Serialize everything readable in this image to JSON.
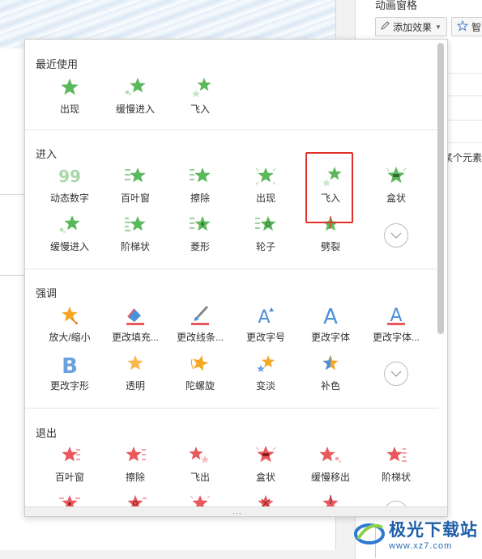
{
  "pane": {
    "title": "动画窗格",
    "add_effect": "添加效果",
    "smart_partial": "智",
    "element_text": "某个元素"
  },
  "watermark": {
    "title": "极光下载站",
    "url": "www.xz7.com"
  },
  "sections": {
    "recent": {
      "title": "最近使用",
      "items": [
        "出现",
        "缓慢进入",
        "飞入"
      ]
    },
    "entrance": {
      "title": "进入",
      "row1": [
        "动态数字",
        "百叶窗",
        "擦除",
        "出现",
        "飞入",
        "盒状"
      ],
      "row2": [
        "缓慢进入",
        "阶梯状",
        "菱形",
        "轮子",
        "劈裂"
      ]
    },
    "emphasis": {
      "title": "强调",
      "row1": [
        "放大/缩小",
        "更改填充...",
        "更改线条...",
        "更改字号",
        "更改字体",
        "更改字体..."
      ],
      "row2": [
        "更改字形",
        "透明",
        "陀螺旋",
        "变淡",
        "补色"
      ]
    },
    "exit": {
      "title": "退出",
      "row1": [
        "百叶窗",
        "擦除",
        "飞出",
        "盒状",
        "缓慢移出",
        "阶梯状"
      ]
    }
  },
  "bottom": {
    "grip": "···"
  },
  "colors": {
    "entrance": "#5cb85c",
    "emphasis_orange": "#f5a623",
    "emphasis_blue": "#4a90d9",
    "exit": "#e8585c",
    "highlight": "#e0302a"
  }
}
